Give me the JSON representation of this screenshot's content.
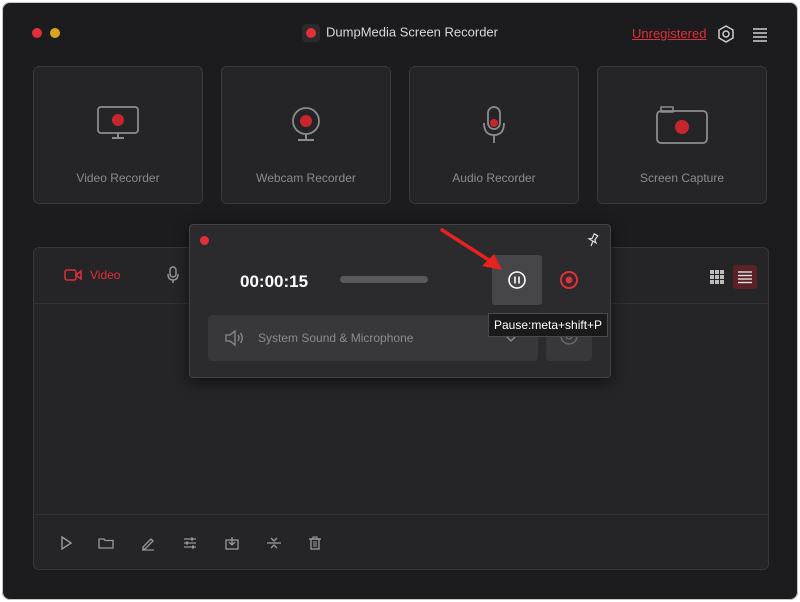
{
  "app": {
    "title": "DumpMedia Screen Recorder",
    "unregistered_label": "Unregistered",
    "accent_color": "#e0303a"
  },
  "toolbar_icons": [
    "settings-gear-icon",
    "menu-icon"
  ],
  "tiles": [
    {
      "label": "Video Recorder",
      "icon": "monitor-icon"
    },
    {
      "label": "Webcam Recorder",
      "icon": "webcam-icon"
    },
    {
      "label": "Audio Recorder",
      "icon": "microphone-icon"
    },
    {
      "label": "Screen Capture",
      "icon": "camera-icon"
    }
  ],
  "panel": {
    "tab_video_label": "Video"
  },
  "recorder_popup": {
    "timer": "00:00:15",
    "sound_source": "System Sound & Microphone",
    "tooltip": "Pause:meta+shift+P"
  },
  "bottom_icons": [
    "play-icon",
    "folder-icon",
    "edit-icon",
    "settings-sliders-icon",
    "export-icon",
    "merge-icon",
    "trash-icon"
  ]
}
